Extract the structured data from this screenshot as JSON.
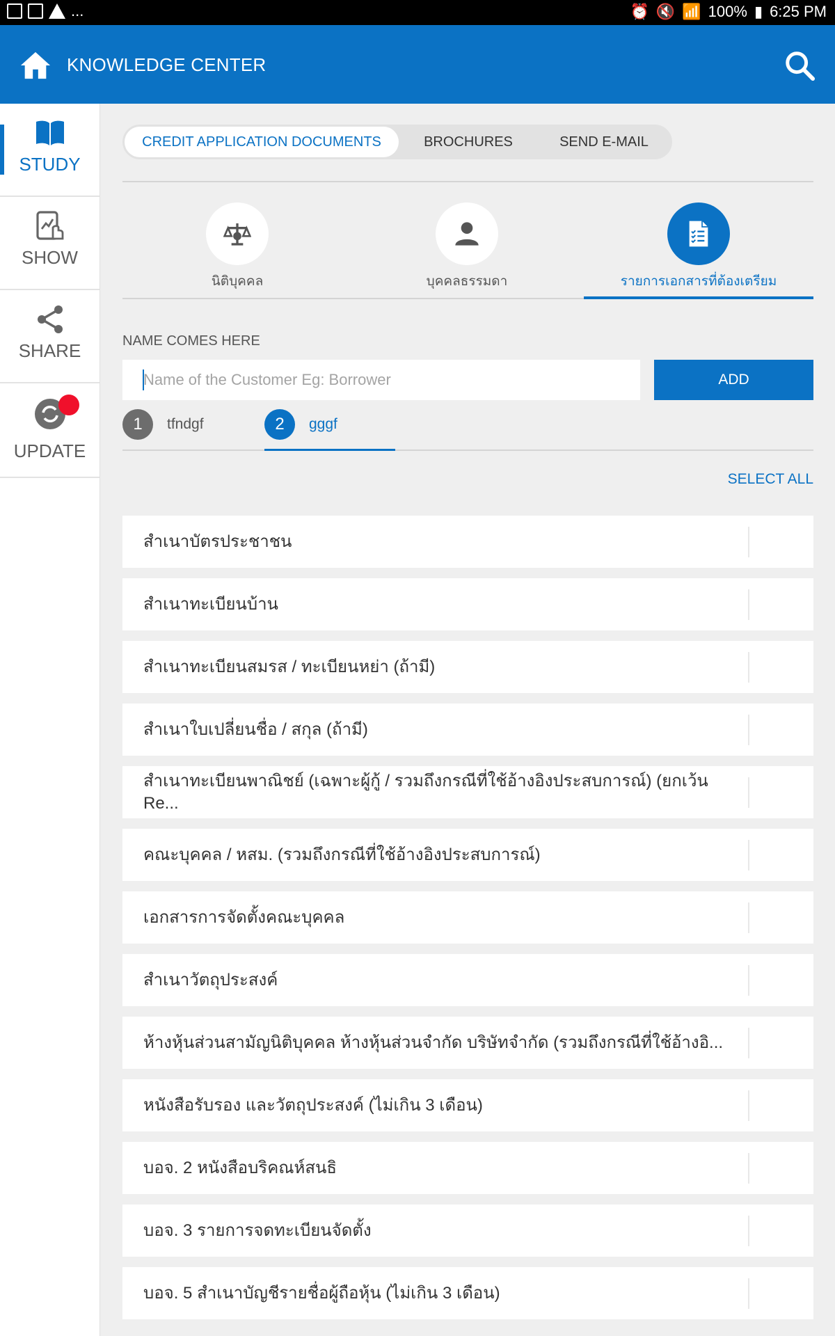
{
  "status_bar": {
    "left_dots": "...",
    "battery": "100%",
    "time": "6:25 PM"
  },
  "header": {
    "title": "KNOWLEDGE CENTER",
    "home_icon": "home-icon",
    "search_icon": "search-icon"
  },
  "sidebar": {
    "items": [
      {
        "label": "STUDY",
        "icon": "book-icon",
        "active": true
      },
      {
        "label": "SHOW",
        "icon": "tablet-touch-icon",
        "active": false
      },
      {
        "label": "SHARE",
        "icon": "share-icon",
        "active": false
      },
      {
        "label": "UPDATE",
        "icon": "sync-icon",
        "active": false
      }
    ]
  },
  "tabs": [
    {
      "label": "CREDIT APPLICATION DOCUMENTS",
      "active": true
    },
    {
      "label": "BROCHURES",
      "active": false
    },
    {
      "label": "SEND E-MAIL",
      "active": false
    }
  ],
  "categories": [
    {
      "label": "นิติบุคคล",
      "icon": "balance-scale-icon",
      "active": false
    },
    {
      "label": "บุคคลธรรมดา",
      "icon": "person-icon",
      "active": false
    },
    {
      "label": "รายการเอกสารที่ต้องเตรียม",
      "icon": "checklist-document-icon",
      "active": true
    }
  ],
  "form": {
    "label": "NAME COMES HERE",
    "placeholder": "Name of the Customer Eg: Borrower",
    "add_label": "ADD"
  },
  "persons": [
    {
      "num": "1",
      "name": "tfndgf",
      "active": false
    },
    {
      "num": "2",
      "name": "gggf",
      "active": true
    }
  ],
  "select_all": "SELECT ALL",
  "documents": [
    "สำเนาบัตรประชาชน",
    "สำเนาทะเบียนบ้าน",
    "สำเนาทะเบียนสมรส / ทะเบียนหย่า (ถ้ามี)",
    "สำเนาใบเปลี่ยนชื่อ / สกุล (ถ้ามี)",
    "สำเนาทะเบียนพาณิชย์ (เฉพาะผู้กู้ / รวมถึงกรณีที่ใช้อ้างอิงประสบการณ์) (ยกเว้น Re...",
    "คณะบุคคล / หสม. (รวมถึงกรณีที่ใช้อ้างอิงประสบการณ์)",
    "เอกสารการจัดตั้งคณะบุคคล",
    "สำเนาวัตถุประสงค์",
    "ห้างหุ้นส่วนสามัญนิติบุคคล ห้างหุ้นส่วนจำกัด บริษัทจำกัด (รวมถึงกรณีที่ใช้อ้างอิ...",
    "หนังสือรับรอง และวัตถุประสงค์ (ไม่เกิน 3 เดือน)",
    "บอจ. 2 หนังสือบริคณห์สนธิ",
    "บอจ. 3 รายการจดทะเบียนจัดตั้ง",
    "บอจ. 5 สำเนาบัญชีรายชื่อผู้ถือหุ้น (ไม่เกิน 3 เดือน)"
  ],
  "colors": {
    "accent": "#0b72c4",
    "badge": "#f0102b"
  }
}
